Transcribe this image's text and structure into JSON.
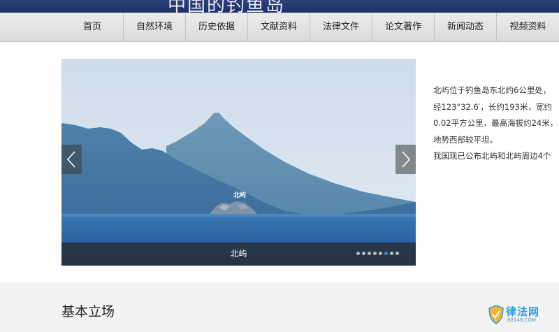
{
  "banner": {
    "title": "中国的钓鱼岛"
  },
  "nav": {
    "items": [
      {
        "label": "首页"
      },
      {
        "label": "自然环境"
      },
      {
        "label": "历史依据"
      },
      {
        "label": "文献资料"
      },
      {
        "label": "法律文件"
      },
      {
        "label": "论文著作"
      },
      {
        "label": "新闻动态"
      },
      {
        "label": "视频资料"
      }
    ]
  },
  "slider": {
    "image_label": "北屿",
    "caption": "北屿",
    "dot_count": 8,
    "active_dot": 6,
    "colors": {
      "active_dot": "#2a8de0",
      "inactive_dot": "#b9b9b9"
    }
  },
  "description": {
    "lines": [
      "北屿位于钓鱼岛东北约6公里处，",
      "经123°32.6′，长约193米，宽约",
      "0.02平方公里，最高海拔约24米，",
      "地势西部较平坦。",
      "我国现已公布北屿和北屿周边4个"
    ]
  },
  "section": {
    "title": "基本立场"
  },
  "watermark": {
    "text": "律法网",
    "sub": "88148.COM"
  }
}
